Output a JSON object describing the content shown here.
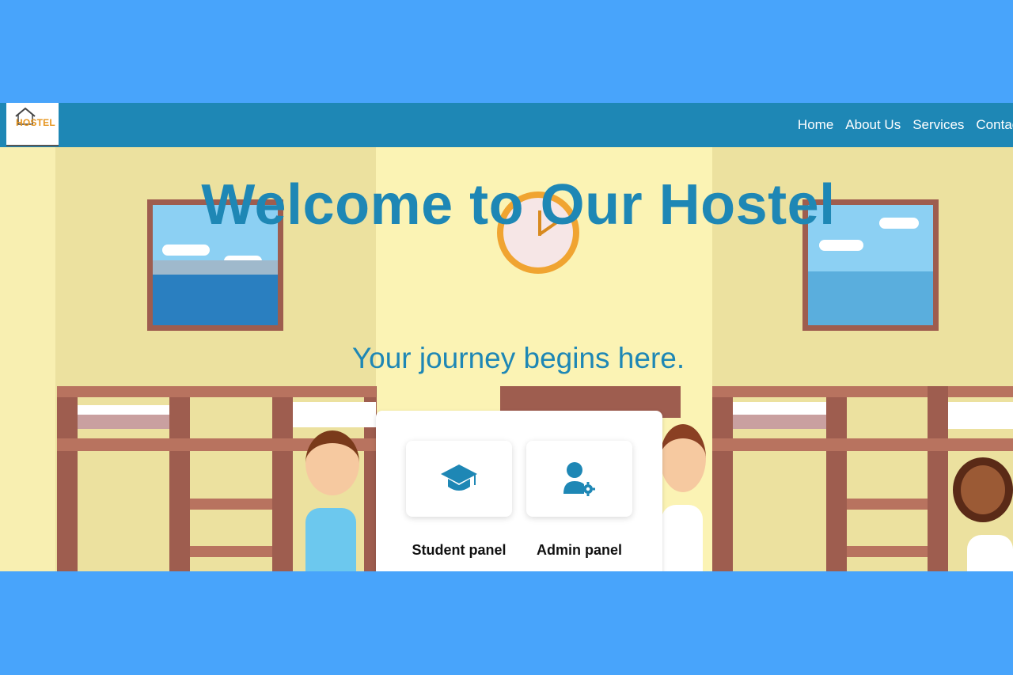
{
  "navbar": {
    "logo_text": "HOSTEL",
    "links": [
      {
        "label": "Home"
      },
      {
        "label": "About Us"
      },
      {
        "label": "Services"
      },
      {
        "label": "Contact"
      }
    ]
  },
  "hero": {
    "title": "Welcome to Our Hostel",
    "subtitle": "Your journey begins here."
  },
  "panels": [
    {
      "label": "Student panel",
      "icon": "graduation-cap-icon"
    },
    {
      "label": "Admin panel",
      "icon": "admin-user-gear-icon"
    }
  ],
  "colors": {
    "outer_background": "#48a4fb",
    "navbar": "#1e87b5",
    "heading": "#1e87b5",
    "logo_text": "#e6951f"
  }
}
